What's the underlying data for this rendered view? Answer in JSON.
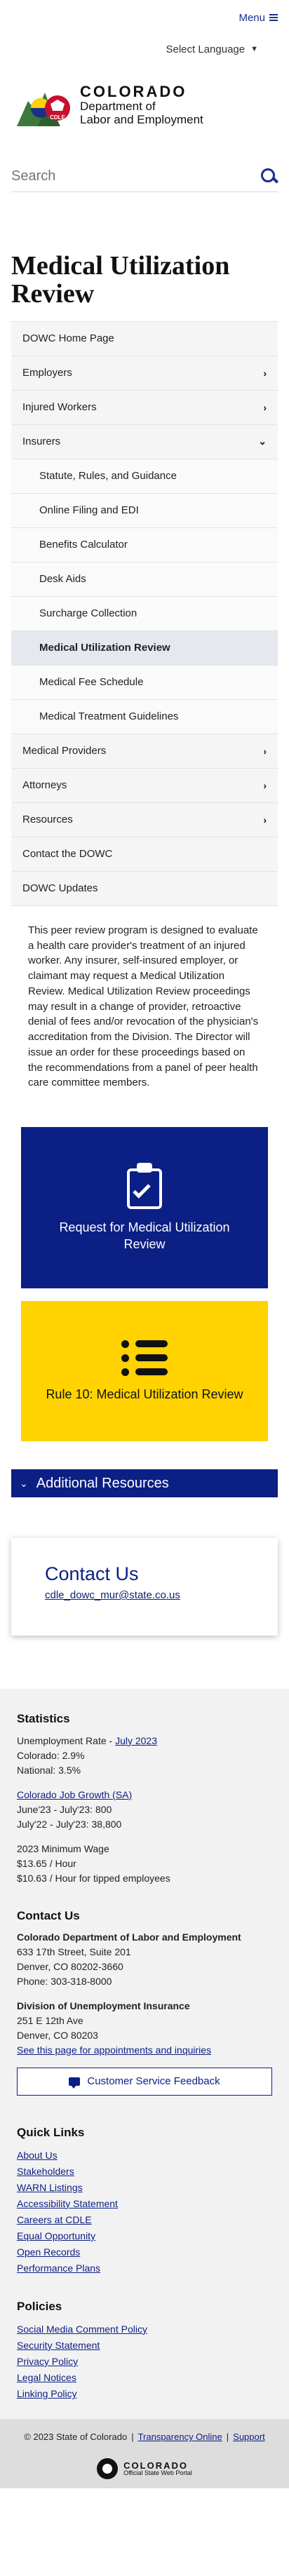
{
  "header": {
    "menu_label": "Menu",
    "language_label": "Select Language",
    "brand_state": "COLORADO",
    "brand_dept_line1": "Department of",
    "brand_dept_line2": "Labor and Employment",
    "logo_badge": "CDLE",
    "search_placeholder": "Search"
  },
  "page_title": "Medical Utilization Review",
  "sidenav": {
    "items": [
      {
        "label": "DOWC Home Page"
      },
      {
        "label": "Employers"
      },
      {
        "label": "Injured Workers"
      },
      {
        "label": "Insurers"
      },
      {
        "label": "Statute, Rules, and Guidance"
      },
      {
        "label": "Online Filing and EDI"
      },
      {
        "label": "Benefits Calculator"
      },
      {
        "label": "Desk Aids"
      },
      {
        "label": "Surcharge Collection"
      },
      {
        "label": "Medical Utilization Review"
      },
      {
        "label": "Medical Fee Schedule"
      },
      {
        "label": "Medical Treatment Guidelines"
      },
      {
        "label": "Medical Providers"
      },
      {
        "label": "Attorneys"
      },
      {
        "label": "Resources"
      },
      {
        "label": "Contact the DOWC"
      },
      {
        "label": "DOWC Updates"
      }
    ]
  },
  "intro_text": "This peer review program is designed to evaluate a health care provider's treatment of an injured worker. Any insurer, self-insured employer, or claimant may request a Medical Utilization Review. Medical Utilization Review proceedings may result in a change of provider, retroactive denial of fees and/or revocation of the physician's accreditation from the Division.  The Director will issue an order for these proceedings based on the recommendations from a panel of peer health care committee members.",
  "tiles": {
    "request": "Request for Medical Utilization Review",
    "rule10": "Rule 10: Medical Utilization Review"
  },
  "additional_resources": "Additional Resources",
  "contact_card": {
    "title": "Contact Us",
    "email": "cdle_dowc_mur@state.co.us"
  },
  "footer": {
    "statistics_title": "Statistics",
    "unemployment_prefix": "Unemployment Rate - ",
    "unemployment_link": "July 2023",
    "colorado_rate": "Colorado: 2.9%",
    "national_rate": "National: 3.5%",
    "job_growth_link": "Colorado Job Growth (SA)",
    "job_growth_1": "June'23 - July'23: 800",
    "job_growth_2": "July'22 - July'23: 38,800",
    "min_wage_title": "2023 Minimum Wage",
    "min_wage_1": "$13.65 / Hour",
    "min_wage_2": "$10.63 / Hour for tipped employees",
    "contact_title": "Contact Us",
    "dept_name": "Colorado Department of Labor and Employment",
    "dept_addr1": "633 17th Street, Suite 201",
    "dept_addr2": "Denver, CO  80202-3660",
    "dept_phone": "Phone: 303-318-8000",
    "ui_name": "Division of Unemployment Insurance",
    "ui_addr1": "251 E 12th Ave",
    "ui_addr2": "Denver, CO  80203",
    "appointments_link": "See this page for appointments and inquiries",
    "feedback_button": "Customer Service Feedback",
    "quick_links_title": "Quick Links",
    "quick_links": [
      "About Us",
      "Stakeholders",
      "WARN Listings",
      "Accessibility Statement",
      "Careers at CDLE",
      "Equal Opportunity",
      "Open Records",
      "Performance Plans"
    ],
    "policies_title": "Policies",
    "policies": [
      "Social Media Comment Policy",
      "Security Statement",
      "Privacy Policy",
      "Legal Notices",
      "Linking Policy"
    ]
  },
  "bottombar": {
    "copyright": "© 2023 State of Colorado",
    "sep": "|",
    "transparency": "Transparency Online",
    "support": "Support",
    "logo_state": "COLORADO",
    "logo_sub": "Official State Web Portal"
  },
  "colors": {
    "brand_blue": "#0b1f84",
    "gold": "#ffd200"
  }
}
